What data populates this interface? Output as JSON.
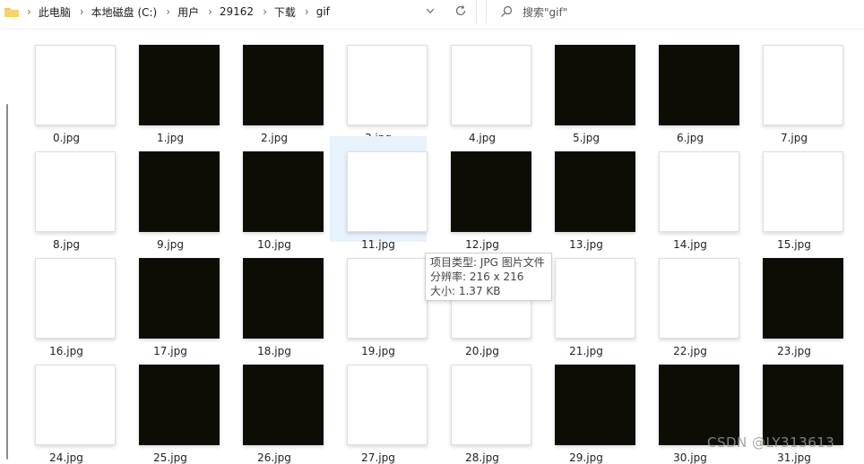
{
  "addressBar": {
    "breadcrumbs": [
      "此电脑",
      "本地磁盘 (C:)",
      "用户",
      "29162",
      "下载",
      "gif"
    ]
  },
  "search": {
    "placeholder": "搜索\"gif\""
  },
  "files": {
    "items": [
      {
        "name": "0.jpg",
        "thumb": "white"
      },
      {
        "name": "1.jpg",
        "thumb": "black"
      },
      {
        "name": "2.jpg",
        "thumb": "black"
      },
      {
        "name": "3.jpg",
        "thumb": "white"
      },
      {
        "name": "4.jpg",
        "thumb": "white"
      },
      {
        "name": "5.jpg",
        "thumb": "black"
      },
      {
        "name": "6.jpg",
        "thumb": "black"
      },
      {
        "name": "7.jpg",
        "thumb": "white"
      },
      {
        "name": "8.jpg",
        "thumb": "white"
      },
      {
        "name": "9.jpg",
        "thumb": "black"
      },
      {
        "name": "10.jpg",
        "thumb": "black"
      },
      {
        "name": "11.jpg",
        "thumb": "white",
        "selected": true
      },
      {
        "name": "12.jpg",
        "thumb": "black"
      },
      {
        "name": "13.jpg",
        "thumb": "black"
      },
      {
        "name": "14.jpg",
        "thumb": "white"
      },
      {
        "name": "15.jpg",
        "thumb": "white"
      },
      {
        "name": "16.jpg",
        "thumb": "white"
      },
      {
        "name": "17.jpg",
        "thumb": "black"
      },
      {
        "name": "18.jpg",
        "thumb": "black"
      },
      {
        "name": "19.jpg",
        "thumb": "white"
      },
      {
        "name": "20.jpg",
        "thumb": "white"
      },
      {
        "name": "21.jpg",
        "thumb": "white"
      },
      {
        "name": "22.jpg",
        "thumb": "white"
      },
      {
        "name": "23.jpg",
        "thumb": "black"
      },
      {
        "name": "24.jpg",
        "thumb": "white"
      },
      {
        "name": "25.jpg",
        "thumb": "black"
      },
      {
        "name": "26.jpg",
        "thumb": "black"
      },
      {
        "name": "27.jpg",
        "thumb": "white"
      },
      {
        "name": "28.jpg",
        "thumb": "white"
      },
      {
        "name": "29.jpg",
        "thumb": "black"
      },
      {
        "name": "30.jpg",
        "thumb": "black"
      },
      {
        "name": "31.jpg",
        "thumb": "black"
      }
    ]
  },
  "tooltip": {
    "line1": "项目类型: JPG 图片文件",
    "line2": "分辨率: 216 x 216",
    "line3": "大小: 1.37 KB"
  },
  "watermark": {
    "text": "CSDN @LY313613"
  },
  "colors": {
    "blackThumb": "#0d0d05",
    "selection": "#e8f2fd"
  }
}
